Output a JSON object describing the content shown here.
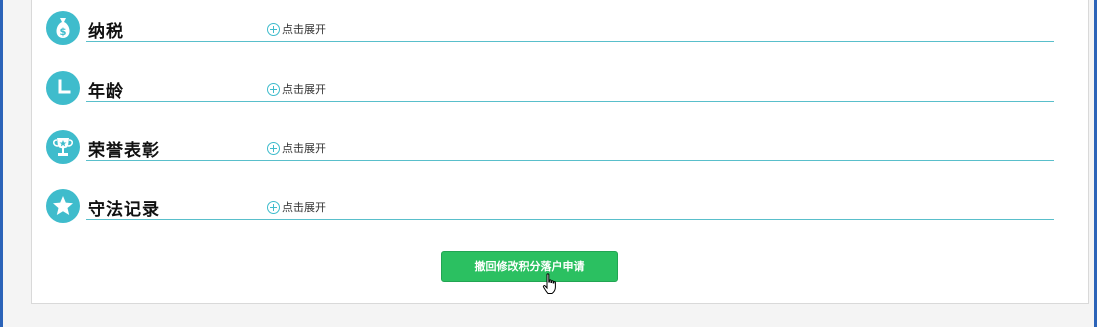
{
  "sections": [
    {
      "title": "纳税",
      "expand_label": "点击展开",
      "icon": "money-bag-icon"
    },
    {
      "title": "年龄",
      "expand_label": "点击展开",
      "icon": "clock-icon"
    },
    {
      "title": "荣誉表彰",
      "expand_label": "点击展开",
      "icon": "trophy-icon"
    },
    {
      "title": "守法记录",
      "expand_label": "点击展开",
      "icon": "star-icon"
    }
  ],
  "actions": {
    "revoke_label": "撤回修改积分落户申请"
  },
  "colors": {
    "accent_teal": "#3fbccc",
    "button_green": "#2bc061",
    "frame_blue": "#2b63b8"
  }
}
